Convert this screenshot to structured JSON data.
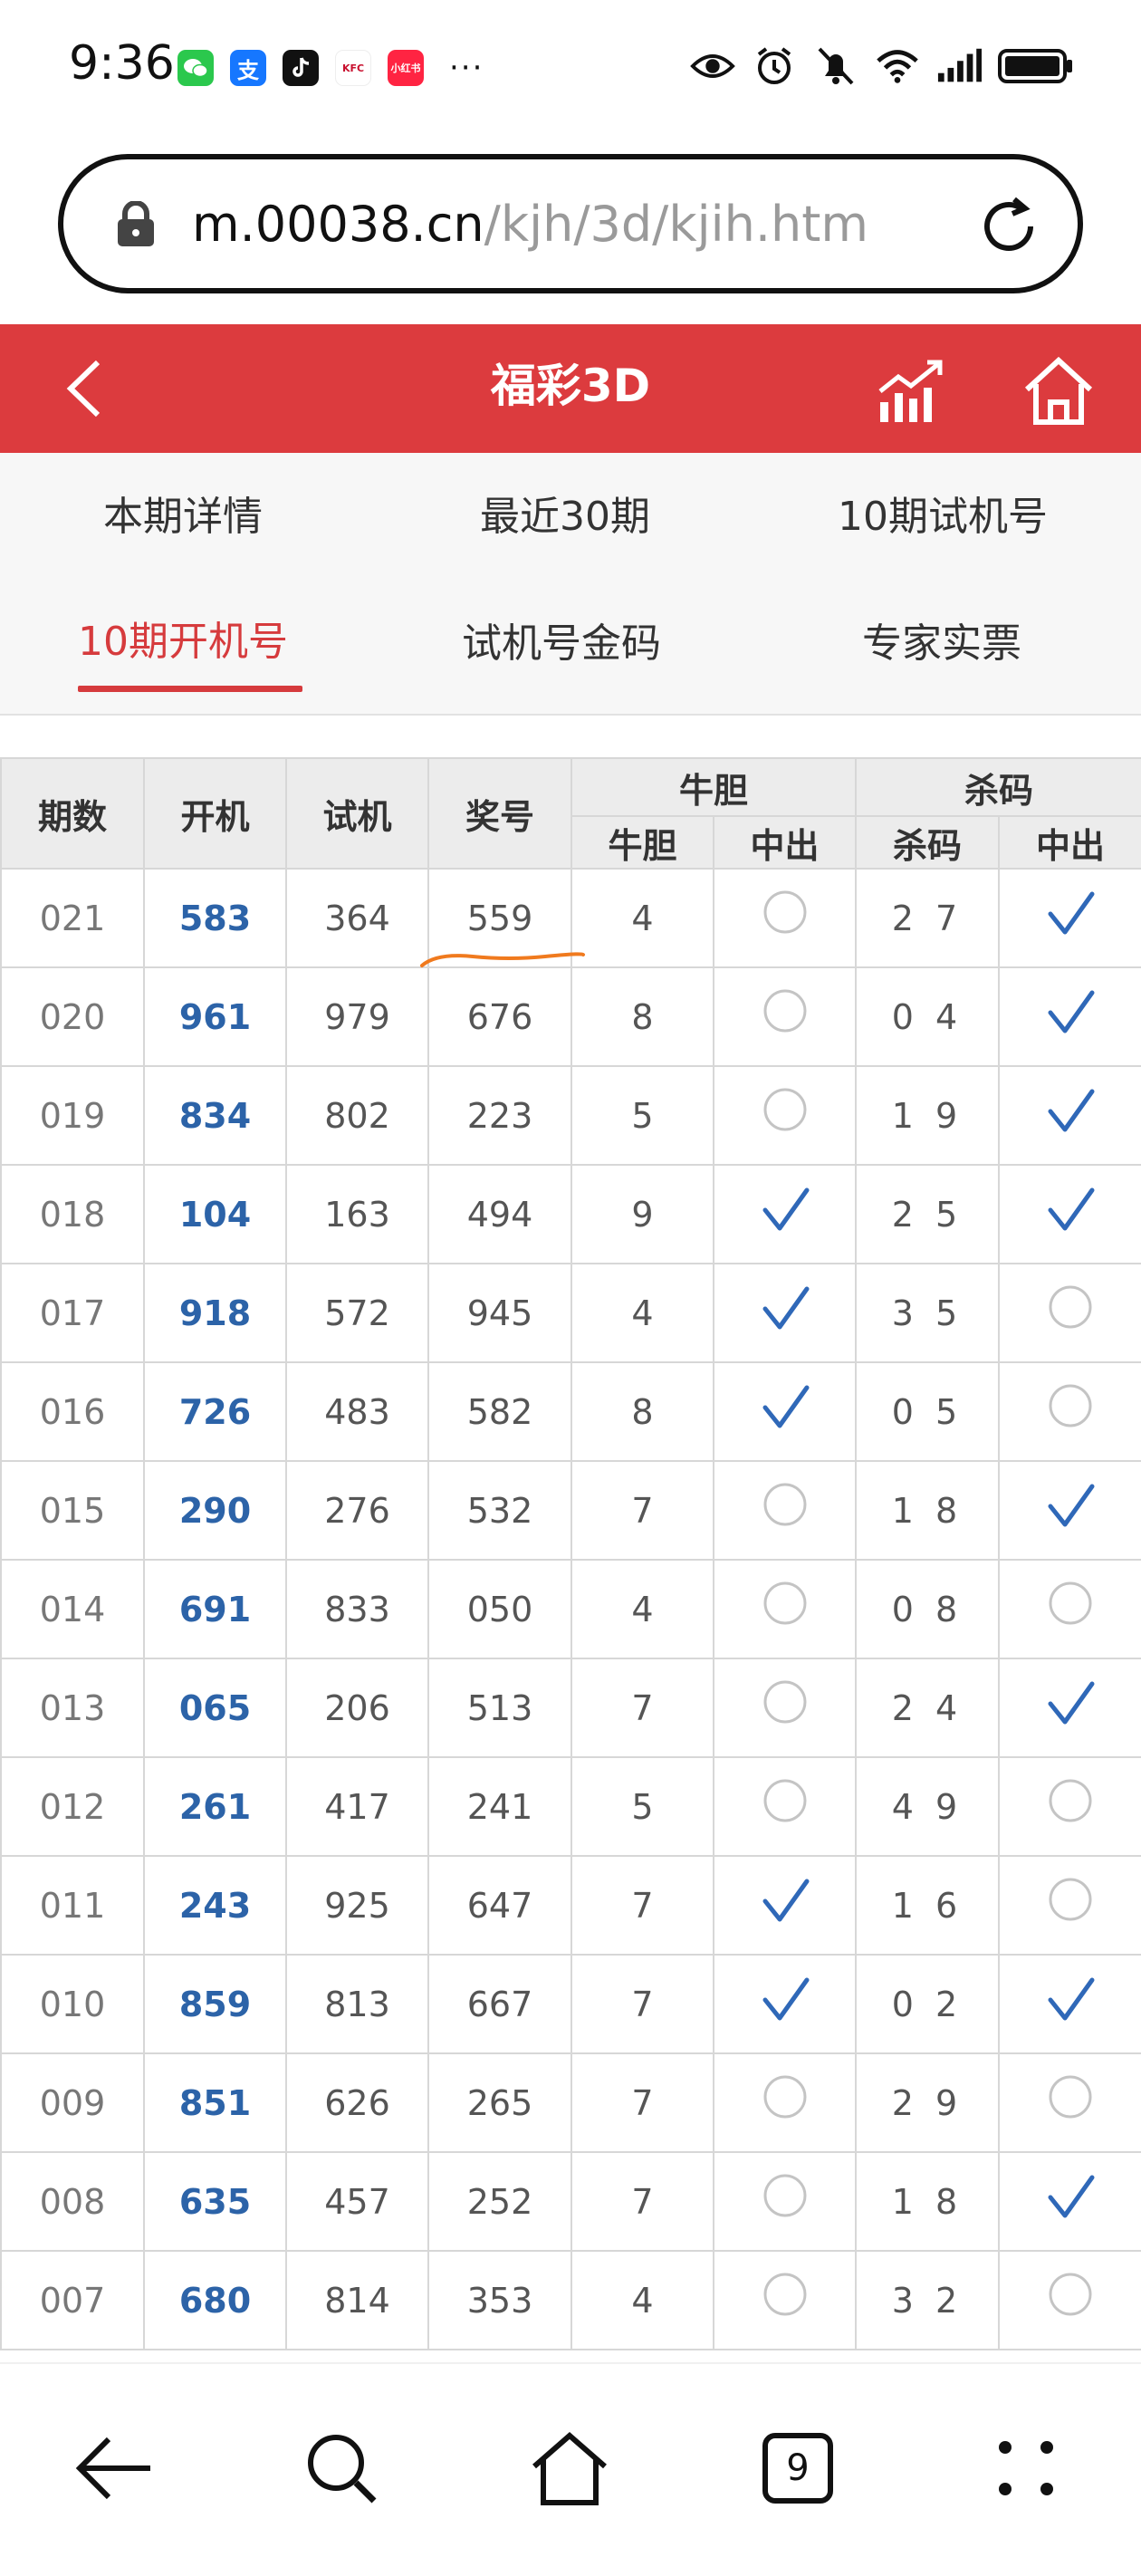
{
  "status_bar": {
    "time": "9:36",
    "app_icons": [
      {
        "name": "wechat-icon",
        "label": "",
        "color": "#2bc84d"
      },
      {
        "name": "alipay-icon",
        "label": "支",
        "color": "#1677ff"
      },
      {
        "name": "douyin-icon",
        "label": "",
        "color": "#111111"
      },
      {
        "name": "kfc-icon",
        "label": "KFC",
        "color": "#ffffff"
      },
      {
        "name": "xiaohongshu-icon",
        "label": "小红书",
        "color": "#ff2442"
      }
    ],
    "more": "···"
  },
  "url_bar": {
    "host": "m.00038.cn",
    "path": "/kjh/3d/kjih.htm"
  },
  "header": {
    "title": "福彩3D"
  },
  "tabs": [
    {
      "label": "本期详情"
    },
    {
      "label": "最近30期"
    },
    {
      "label": "10期试机号"
    },
    {
      "label": "10期开机号",
      "active": true
    },
    {
      "label": "试机号金码"
    },
    {
      "label": "专家实票"
    }
  ],
  "table": {
    "headers": {
      "issue": "期数",
      "open": "开机",
      "trial": "试机",
      "prize": "奖号",
      "niudan_group": "牛胆",
      "kill_group": "杀码",
      "niudan": "牛胆",
      "niudan_hit": "中出",
      "kill": "杀码",
      "kill_hit": "中出"
    },
    "rows": [
      {
        "issue": "021",
        "open": "583",
        "trial": "364",
        "prize": "559",
        "niudan": "4",
        "niudan_hit": false,
        "kill": "2 7",
        "kill_hit": true
      },
      {
        "issue": "020",
        "open": "961",
        "trial": "979",
        "prize": "676",
        "niudan": "8",
        "niudan_hit": false,
        "kill": "0 4",
        "kill_hit": true
      },
      {
        "issue": "019",
        "open": "834",
        "trial": "802",
        "prize": "223",
        "niudan": "5",
        "niudan_hit": false,
        "kill": "1 9",
        "kill_hit": true
      },
      {
        "issue": "018",
        "open": "104",
        "trial": "163",
        "prize": "494",
        "niudan": "9",
        "niudan_hit": true,
        "kill": "2 5",
        "kill_hit": true
      },
      {
        "issue": "017",
        "open": "918",
        "trial": "572",
        "prize": "945",
        "niudan": "4",
        "niudan_hit": true,
        "kill": "3 5",
        "kill_hit": false
      },
      {
        "issue": "016",
        "open": "726",
        "trial": "483",
        "prize": "582",
        "niudan": "8",
        "niudan_hit": true,
        "kill": "0 5",
        "kill_hit": false
      },
      {
        "issue": "015",
        "open": "290",
        "trial": "276",
        "prize": "532",
        "niudan": "7",
        "niudan_hit": false,
        "kill": "1 8",
        "kill_hit": true
      },
      {
        "issue": "014",
        "open": "691",
        "trial": "833",
        "prize": "050",
        "niudan": "4",
        "niudan_hit": false,
        "kill": "0 8",
        "kill_hit": false
      },
      {
        "issue": "013",
        "open": "065",
        "trial": "206",
        "prize": "513",
        "niudan": "7",
        "niudan_hit": false,
        "kill": "2 4",
        "kill_hit": true
      },
      {
        "issue": "012",
        "open": "261",
        "trial": "417",
        "prize": "241",
        "niudan": "5",
        "niudan_hit": false,
        "kill": "4 9",
        "kill_hit": false
      },
      {
        "issue": "011",
        "open": "243",
        "trial": "925",
        "prize": "647",
        "niudan": "7",
        "niudan_hit": true,
        "kill": "1 6",
        "kill_hit": false
      },
      {
        "issue": "010",
        "open": "859",
        "trial": "813",
        "prize": "667",
        "niudan": "7",
        "niudan_hit": true,
        "kill": "0 2",
        "kill_hit": true
      },
      {
        "issue": "009",
        "open": "851",
        "trial": "626",
        "prize": "265",
        "niudan": "7",
        "niudan_hit": false,
        "kill": "2 9",
        "kill_hit": false
      },
      {
        "issue": "008",
        "open": "635",
        "trial": "457",
        "prize": "252",
        "niudan": "7",
        "niudan_hit": false,
        "kill": "1 8",
        "kill_hit": true
      },
      {
        "issue": "007",
        "open": "680",
        "trial": "814",
        "prize": "353",
        "niudan": "4",
        "niudan_hit": false,
        "kill": "3 2",
        "kill_hit": false
      }
    ]
  },
  "bottom_nav": {
    "tab_count": "9"
  },
  "colors": {
    "brand_red": "#dc3b3e",
    "open_blue": "#2c63a8",
    "check_blue": "#2f68b8",
    "underline_orange": "#f07a1e"
  }
}
